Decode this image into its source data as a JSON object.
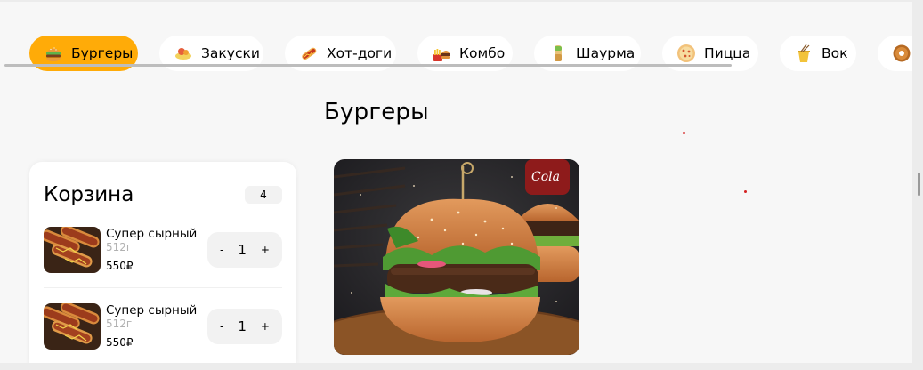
{
  "nav": {
    "categories": [
      {
        "label": "Бургеры",
        "icon": "burger-icon",
        "active": true
      },
      {
        "label": "Закуски",
        "icon": "snack-icon",
        "active": false
      },
      {
        "label": "Хот-доги",
        "icon": "hotdog-icon",
        "active": false
      },
      {
        "label": "Комбо",
        "icon": "combo-icon",
        "active": false
      },
      {
        "label": "Шаурма",
        "icon": "shawarma-icon",
        "active": false
      },
      {
        "label": "Пицца",
        "icon": "pizza-icon",
        "active": false
      },
      {
        "label": "Вок",
        "icon": "wok-icon",
        "active": false
      },
      {
        "label": "",
        "icon": "donut-icon",
        "active": false
      }
    ]
  },
  "page": {
    "title": "Бургеры"
  },
  "cart": {
    "title": "Корзина",
    "count": "4",
    "items": [
      {
        "name": "Супер сырный",
        "weight": "512г",
        "price": "550₽",
        "qty": "1",
        "minus": "-",
        "plus": "+"
      },
      {
        "name": "Супер сырный",
        "weight": "512г",
        "price": "550₽",
        "qty": "1",
        "minus": "-",
        "plus": "+"
      }
    ]
  },
  "colors": {
    "accent": "#ffab08",
    "background": "#f7f7f7",
    "card": "#ffffff",
    "muted": "#b1b1b1"
  }
}
